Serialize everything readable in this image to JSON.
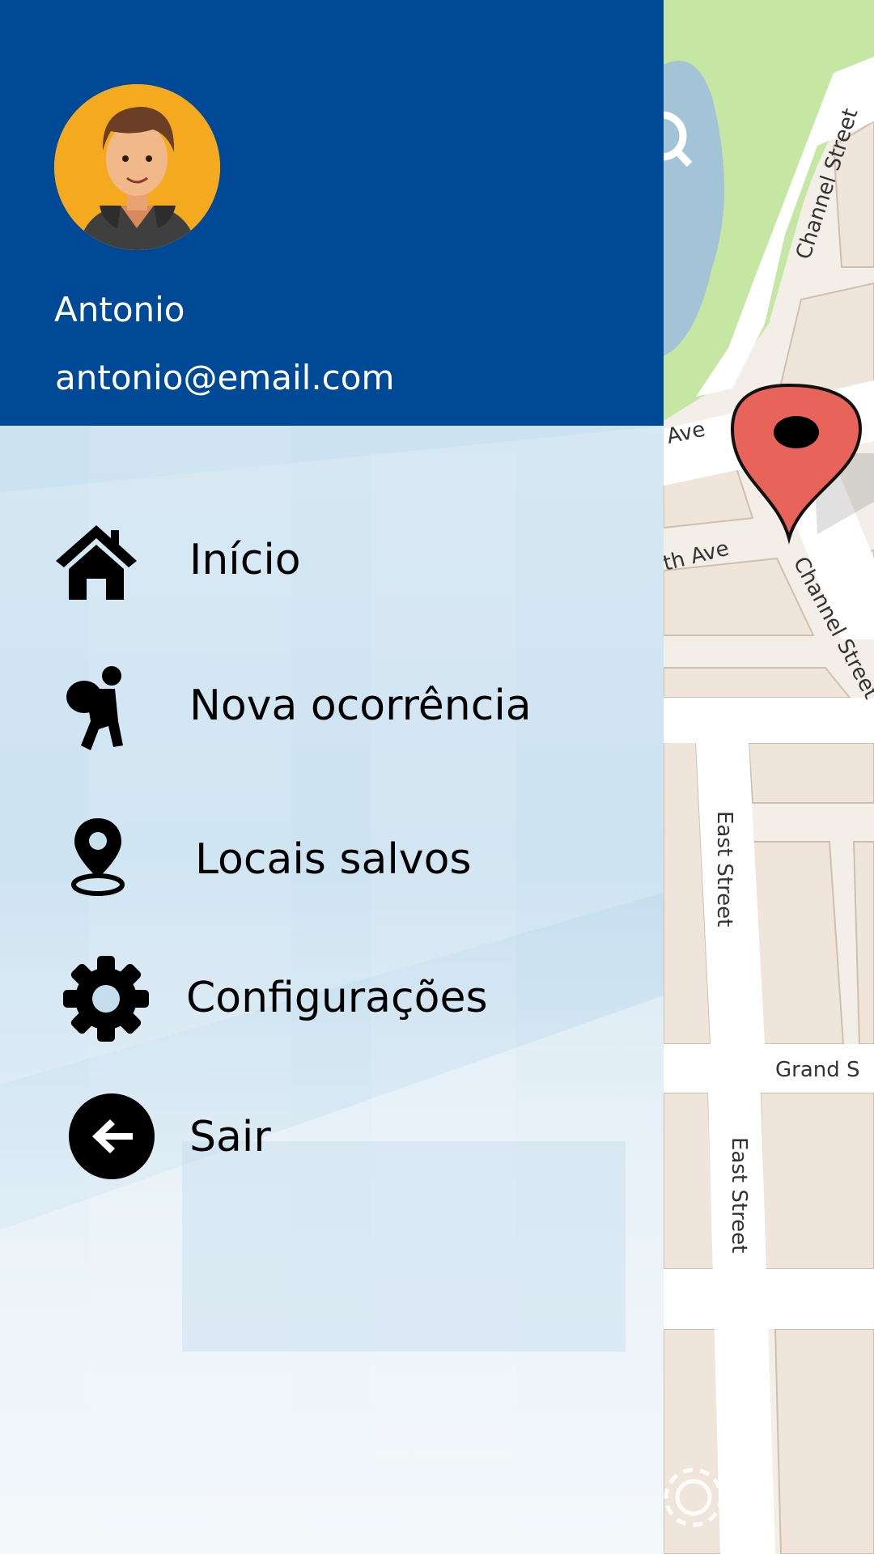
{
  "map": {
    "street_labels": {
      "channel_top": "Channel Street",
      "ave_top": "Ave",
      "ave_mid": "th Ave",
      "channel_mid": "Channel Street",
      "east_1": "East Street",
      "grand": "Grand S",
      "east_2": "East Street"
    },
    "icons": [
      "search-icon",
      "map-pin-icon",
      "settings-icon"
    ]
  },
  "drawer": {
    "user": {
      "name": "Antonio",
      "email": "antonio@email.com"
    },
    "menu": [
      {
        "label": "Início",
        "icon": "home-icon"
      },
      {
        "label": "Nova ocorrência",
        "icon": "thief-icon"
      },
      {
        "label": "Locais salvos",
        "icon": "location-pin-icon"
      },
      {
        "label": "Configurações",
        "icon": "gear-icon"
      },
      {
        "label": "Sair",
        "icon": "logout-arrow-icon"
      }
    ]
  },
  "colors": {
    "header": "#004996",
    "avatar_bg": "#f5a91e",
    "pin": "#e8645a",
    "park": "#c6e6a4",
    "water": "#a3c3d6"
  }
}
